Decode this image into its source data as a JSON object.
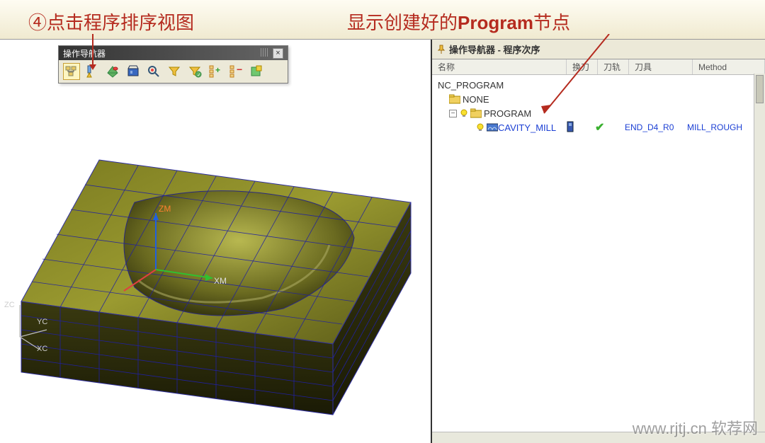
{
  "annotations": {
    "left": "④点击程序排序视图",
    "right_prefix": "显示创建好的",
    "right_bold": "Program",
    "right_suffix": "节点"
  },
  "toolbar": {
    "title": "操作导航器",
    "close": "×",
    "grip": "≡"
  },
  "viewport": {
    "axis_zm": "ZM",
    "axis_xm": "XM",
    "triad_zc": "ZC",
    "triad_yc": "YC",
    "triad_xc": "XC"
  },
  "right_panel": {
    "title": "操作导航器 - 程序次序",
    "columns": {
      "name": "名称",
      "c2": "换刀",
      "c3": "刀轨",
      "c4": "刀具",
      "c5": "Method"
    },
    "tree": {
      "root": "NC_PROGRAM",
      "none": "NONE",
      "program": "PROGRAM",
      "op": {
        "name": "CAVITY_MILL",
        "check": "✔",
        "tool": "END_D4_R0",
        "method": "MILL_ROUGH"
      }
    }
  },
  "watermark": "www.rjtj.cn 软荐网",
  "watermark2": ""
}
